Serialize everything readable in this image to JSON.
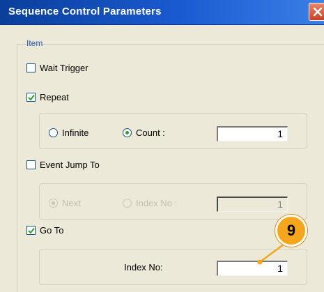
{
  "window": {
    "title": "Sequence Control Parameters",
    "close_icon": "close-icon"
  },
  "item_label": "Item",
  "wait_trigger": {
    "label": "Wait Trigger",
    "checked": false
  },
  "repeat": {
    "label": "Repeat",
    "checked": true,
    "infinite_label": "Infinite",
    "count_label": "Count :",
    "selected": "count",
    "count_value": "1"
  },
  "event_jump_to": {
    "label": "Event Jump To",
    "checked": false,
    "next_label": "Next",
    "index_label": "Index No :",
    "index_value": "1",
    "enabled": false
  },
  "go_to": {
    "label": "Go To",
    "checked": true,
    "index_label": "Index No:",
    "index_value": "1"
  },
  "callout": {
    "number": "9",
    "color": "#f5a61d"
  },
  "colors": {
    "title_bar": "#1a5ad1",
    "check_mark": "#2ea02e",
    "group_label": "#2459b7"
  }
}
